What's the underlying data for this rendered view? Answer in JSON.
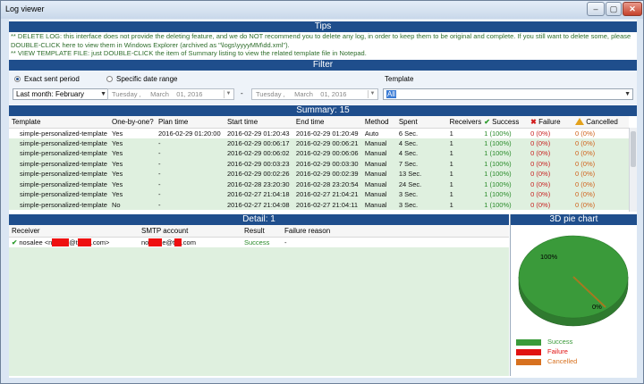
{
  "window": {
    "title": "Log viewer",
    "min_glyph": "–",
    "max_glyph": "▢",
    "close_glyph": "✕"
  },
  "tips": {
    "header": "Tips",
    "line1": "** DELETE LOG: this interface does not provide the deleting feature, and we do NOT recommend you to delete any log, in order to keep them to be original and complete. If you still want to delete some, please DOUBLE-CLICK here to view them in Windows Explorer (archived as \"\\logs\\yyyyMM\\dd.xml\").",
    "line2": "** VIEW TEMPLATE FILE: just DOUBLE-CLICK the item of Summary listing to view the related template file in Notepad."
  },
  "filter": {
    "header": "Filter",
    "exact_label": "Exact sent period",
    "specific_label": "Specific date range",
    "template_label": "Template",
    "period_value": "Last month: February",
    "date_from": {
      "weekday": "Tuesday",
      "month": "March",
      "day": "01, 2016"
    },
    "date_sep": "-",
    "date_to": {
      "weekday": "Tuesday",
      "month": "March",
      "day": "01, 2016"
    },
    "template_value": "All"
  },
  "summary": {
    "header": "Summary: 15",
    "columns": [
      "Template",
      "One-by-one?",
      "Plan time",
      "Start time",
      "End time",
      "Method",
      "Spent",
      "Receivers",
      "Success",
      "Failure",
      "Cancelled"
    ],
    "rows": [
      [
        "simple-personalized-template",
        "Yes",
        "2016-02-29 01:20:00",
        "2016-02-29 01:20:43",
        "2016-02-29 01:20:49",
        "Auto",
        "6 Sec.",
        "1",
        "1 (100%)",
        "0 (0%)",
        "0 (0%)"
      ],
      [
        "simple-personalized-template",
        "Yes",
        "-",
        "2016-02-29 00:06:17",
        "2016-02-29 00:06:21",
        "Manual",
        "4 Sec.",
        "1",
        "1 (100%)",
        "0 (0%)",
        "0 (0%)"
      ],
      [
        "simple-personalized-template",
        "Yes",
        "-",
        "2016-02-29 00:06:02",
        "2016-02-29 00:06:06",
        "Manual",
        "4 Sec.",
        "1",
        "1 (100%)",
        "0 (0%)",
        "0 (0%)"
      ],
      [
        "simple-personalized-template",
        "Yes",
        "-",
        "2016-02-29 00:03:23",
        "2016-02-29 00:03:30",
        "Manual",
        "7 Sec.",
        "1",
        "1 (100%)",
        "0 (0%)",
        "0 (0%)"
      ],
      [
        "simple-personalized-template",
        "Yes",
        "-",
        "2016-02-29 00:02:26",
        "2016-02-29 00:02:39",
        "Manual",
        "13 Sec.",
        "1",
        "1 (100%)",
        "0 (0%)",
        "0 (0%)"
      ],
      [
        "simple-personalized-template",
        "Yes",
        "-",
        "2016-02-28 23:20:30",
        "2016-02-28 23:20:54",
        "Manual",
        "24 Sec.",
        "1",
        "1 (100%)",
        "0 (0%)",
        "0 (0%)"
      ],
      [
        "simple-personalized-template",
        "Yes",
        "-",
        "2016-02-27 21:04:18",
        "2016-02-27 21:04:21",
        "Manual",
        "3 Sec.",
        "1",
        "1 (100%)",
        "0 (0%)",
        "0 (0%)"
      ],
      [
        "simple-personalized-template",
        "No",
        "-",
        "2016-02-27 21:04:08",
        "2016-02-27 21:04:11",
        "Manual",
        "3 Sec.",
        "1",
        "1 (100%)",
        "0 (0%)",
        "0 (0%)"
      ]
    ]
  },
  "detail": {
    "header": "Detail: 1",
    "columns": [
      "Receiver",
      "SMTP account",
      "Result",
      "Failure reason"
    ],
    "row": {
      "receiver_prefix": "nosalee <n",
      "receiver_at": "@t",
      "receiver_suffix": ".com>",
      "smtp_prefix": "no",
      "smtp_at": "e@t",
      "smtp_suffix": ".com",
      "result": "Success",
      "reason": "-"
    }
  },
  "chart_data": {
    "type": "pie",
    "title": "3D pie chart",
    "categories": [
      "Success",
      "Failure",
      "Cancelled"
    ],
    "values": [
      100,
      0,
      0
    ],
    "slice_labels": [
      "100%",
      "0%"
    ],
    "colors": {
      "Success": "#3a9a3a",
      "Failure": "#e11212",
      "Cancelled": "#d7711f"
    }
  }
}
